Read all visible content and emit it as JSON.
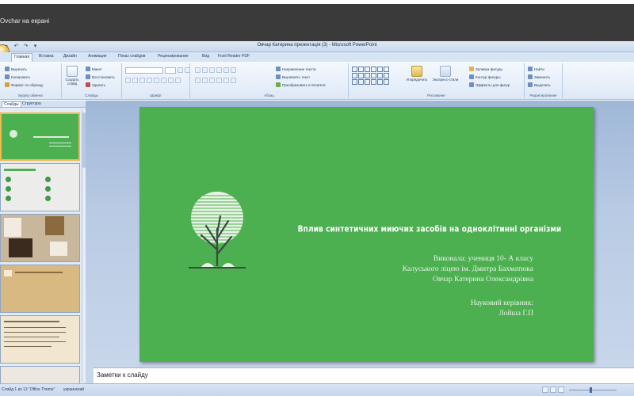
{
  "share_bar": {
    "label": "Ovchar на екрані"
  },
  "window": {
    "title": "Овчар Катерина презентація (3) - Microsoft PowerPoint",
    "qat": [
      "save-icon",
      "undo-icon",
      "redo-icon",
      "dropdown-icon"
    ]
  },
  "ribbon": {
    "tabs": [
      "Главная",
      "Вставка",
      "Дизайн",
      "Анимация",
      "Показ слайдов",
      "Рецензирование",
      "Вид",
      "Foxit Reader PDF"
    ],
    "active_tab": "Главная",
    "clipboard": {
      "paste": "Вставить",
      "cut": "Вырезать",
      "copy": "Копировать",
      "format": "Формат по образцу",
      "group": "Буфер обмена"
    },
    "slides": {
      "new_slide": "Создать слайд",
      "layout": "Макет",
      "reset": "Восстановить",
      "delete": "Удалить",
      "group": "Слайды"
    },
    "font": {
      "group": "Шрифт"
    },
    "paragraph": {
      "dir": "Направление текста",
      "align": "Выровнять текст",
      "smartart": "Преобразовать в SmartArt",
      "group": "Абзац"
    },
    "drawing": {
      "arrange": "Упорядочить",
      "quick_styles": "Экспресс-стили",
      "fill": "Заливка фигуры",
      "outline": "Контур фигуры",
      "effects": "Эффекты для фигур",
      "group": "Рисование"
    },
    "editing": {
      "find": "Найти",
      "replace": "Заменить",
      "select": "Выделить",
      "group": "Редактирование"
    }
  },
  "panel": {
    "tabs": [
      "Слайды",
      "Структура"
    ]
  },
  "slide": {
    "title": "Вплив синтетичних миючих засобів на одноклітинні організми",
    "author_lines": [
      "Виконала: учениця 10- А класу",
      "Калуського ліцею ім. Дмитра Бахматюка",
      "Овчар Катерина Олександрівна"
    ],
    "advisor_lines": [
      "Науковий керівник:",
      "Лойша Г.П"
    ]
  },
  "notes": {
    "label": "Заметки к слайду"
  },
  "status": {
    "slide_info": "Слайд 1 из 13",
    "theme": "\"Office Theme\"",
    "language": "украинский"
  }
}
